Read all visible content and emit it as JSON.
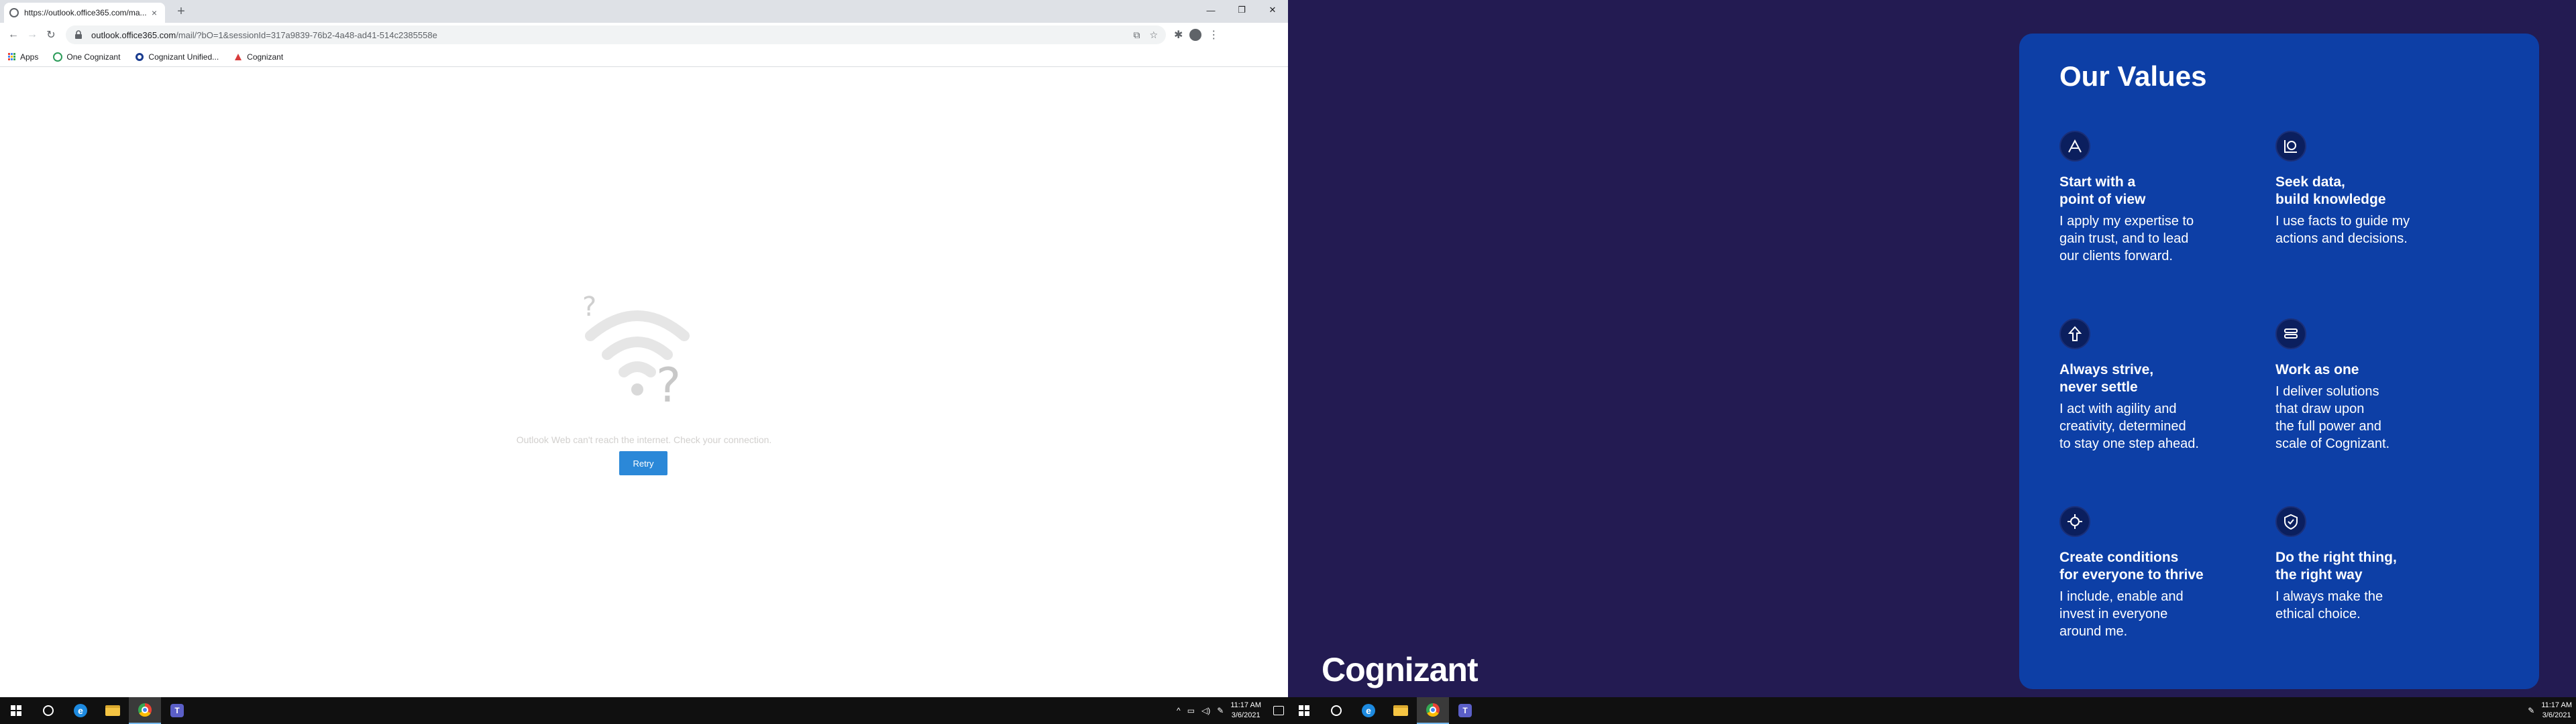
{
  "browser": {
    "tab": {
      "title": "https://outlook.office365.com/ma...",
      "close_glyph": "×"
    },
    "new_tab_glyph": "+",
    "window_controls": {
      "minimize": "—",
      "maximize": "❐",
      "close": "✕"
    },
    "nav": {
      "back": "←",
      "forward": "→",
      "reload": "↻"
    },
    "address": {
      "host": "outlook.office365.com",
      "path": "/mail/?bO=1&sessionId=317a9839-76b2-4a48-ad41-514c2385558e"
    },
    "bookmarks": [
      {
        "label": "Apps",
        "icon": "apps-grid-icon"
      },
      {
        "label": "One Cognizant",
        "icon": "one-cognizant-icon"
      },
      {
        "label": "Cognizant Unified...",
        "icon": "cognizant-unified-icon"
      },
      {
        "label": "Cognizant",
        "icon": "cognizant-icon"
      }
    ]
  },
  "outlook": {
    "offline_message": "Outlook Web can't reach the internet. Check your connection.",
    "retry_label": "Retry"
  },
  "taskbar_left": {
    "time": "11:17 AM",
    "date": "3/6/2021",
    "apps": [
      "start",
      "search",
      "edge",
      "file-explorer",
      "chrome",
      "teams"
    ]
  },
  "taskbar_right": {
    "time": "11:17 AM",
    "date": "3/6/2021"
  },
  "wallpaper": {
    "brand": "Cognizant",
    "card_title": "Our Values",
    "values": [
      {
        "icon": "compass-icon",
        "heading": "Start with a\npoint of view",
        "text": "I apply my expertise to\ngain trust, and to lead\nour clients forward."
      },
      {
        "icon": "data-search-icon",
        "heading": "Seek data,\nbuild knowledge",
        "text": "I use facts to guide my\nactions and decisions."
      },
      {
        "icon": "arrow-up-icon",
        "heading": "Always strive,\nnever settle",
        "text": "I act with agility and\ncreativity, determined\nto stay one step ahead."
      },
      {
        "icon": "team-icon",
        "heading": "Work as one",
        "text": "I deliver solutions\nthat draw upon\nthe full power and\nscale of Cognizant."
      },
      {
        "icon": "gear-people-icon",
        "heading": "Create conditions\nfor everyone to thrive",
        "text": "I include, enable and\ninvest in everyone\naround me."
      },
      {
        "icon": "shield-check-icon",
        "heading": "Do the right thing,\nthe right way",
        "text": "I always make the\nethical choice."
      }
    ],
    "colors": {
      "background": "#231b52",
      "card": "#0d3fa6"
    }
  }
}
